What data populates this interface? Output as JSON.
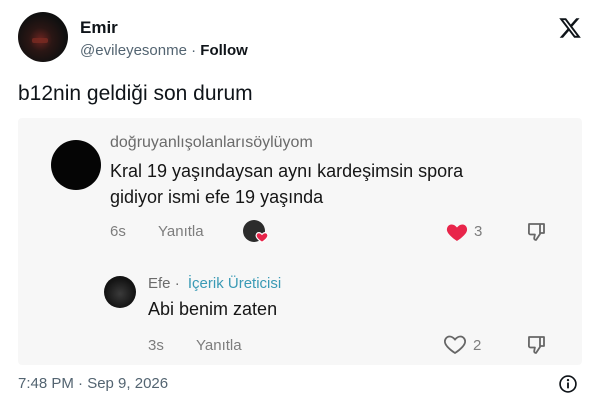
{
  "author": {
    "name": "Emir",
    "handle": "@evileyesonme",
    "separator": "·",
    "follow_label": "Follow"
  },
  "tweet_text": "b12nin geldiği son durum",
  "embedded": {
    "comment1": {
      "username": "doğruyanlışolanlarısöylüyom",
      "line1": "Kral 19 yaşındaysan aynı kardeşimsin spora",
      "line2": "gidiyor ismi efe 19 yaşında",
      "age": "6s",
      "reply_label": "Yanıtla",
      "likes": "3"
    },
    "comment2": {
      "username": "Efe",
      "separator": "·",
      "badge": "İçerik Üreticisi",
      "text": "Abi benim zaten",
      "age": "3s",
      "reply_label": "Yanıtla",
      "likes": "2"
    }
  },
  "timestamp": "7:48 PM · Sep 9, 2026",
  "colors": {
    "liked_heart": "#e8254a",
    "creator_badge": "#3a9ab5",
    "secondary_text": "#536471"
  },
  "icons": [
    "x-logo-icon",
    "heart-filled-icon",
    "heart-outline-icon",
    "dislike-icon",
    "info-icon"
  ]
}
